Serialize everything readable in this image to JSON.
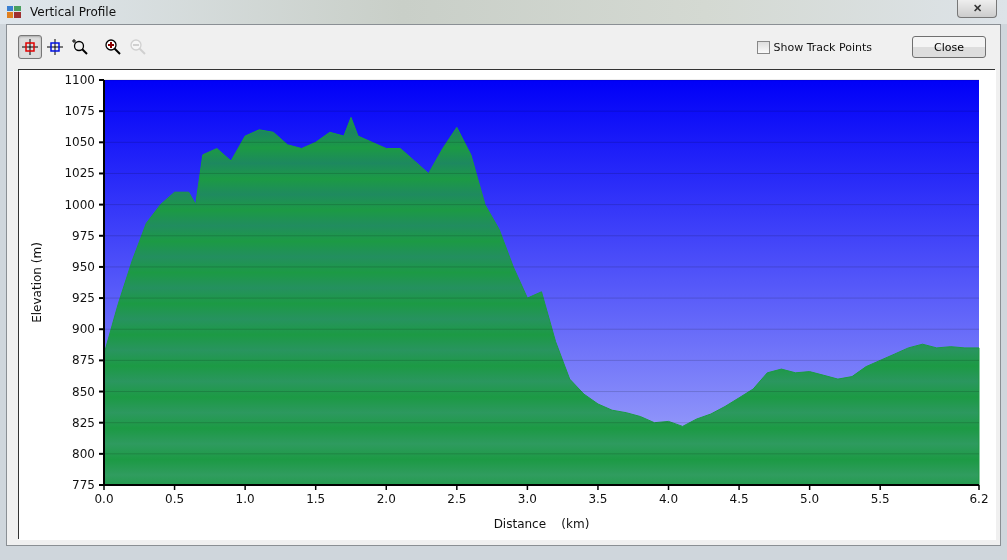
{
  "window": {
    "title": "Vertical Profile",
    "close_glyph": "✕"
  },
  "toolbar": [
    {
      "kind": "pick-red",
      "selected": true,
      "disabled": false
    },
    {
      "kind": "pick-blue",
      "selected": false,
      "disabled": false
    },
    {
      "kind": "zoom-box",
      "selected": false,
      "disabled": false
    },
    {
      "kind": "zoom-in",
      "selected": false,
      "disabled": false
    },
    {
      "kind": "zoom-out",
      "selected": false,
      "disabled": true
    }
  ],
  "show_track_points": {
    "label": "Show Track Points",
    "checked": false
  },
  "close_button": "Close",
  "chart_data": {
    "type": "area",
    "xlabel": "Distance    (km)",
    "ylabel": "Elevation (m)",
    "x": [
      0,
      0.1,
      0.2,
      0.3,
      0.4,
      0.5,
      0.6,
      0.65,
      0.7,
      0.8,
      0.9,
      1.0,
      1.1,
      1.2,
      1.3,
      1.4,
      1.5,
      1.6,
      1.7,
      1.75,
      1.8,
      1.9,
      2.0,
      2.1,
      2.2,
      2.3,
      2.4,
      2.5,
      2.6,
      2.7,
      2.8,
      2.9,
      3.0,
      3.1,
      3.2,
      3.3,
      3.4,
      3.5,
      3.6,
      3.7,
      3.8,
      3.9,
      4.0,
      4.1,
      4.2,
      4.3,
      4.4,
      4.5,
      4.6,
      4.7,
      4.8,
      4.9,
      5.0,
      5.1,
      5.2,
      5.3,
      5.4,
      5.5,
      5.6,
      5.7,
      5.8,
      5.9,
      6.0,
      6.1,
      6.2
    ],
    "series": [
      {
        "color": "#1c9a44",
        "values": [
          880,
          920,
          955,
          985,
          1000,
          1010,
          1010,
          1000,
          1040,
          1045,
          1035,
          1055,
          1060,
          1058,
          1048,
          1045,
          1050,
          1058,
          1055,
          1070,
          1055,
          1050,
          1045,
          1045,
          1035,
          1025,
          1045,
          1062,
          1040,
          1000,
          980,
          950,
          925,
          930,
          890,
          860,
          848,
          840,
          835,
          833,
          830,
          825,
          826,
          822,
          828,
          832,
          838,
          845,
          852,
          865,
          868,
          865,
          866,
          863,
          860,
          862,
          870,
          875,
          880,
          885,
          888,
          885,
          886,
          885,
          885
        ]
      }
    ],
    "grid": true,
    "xlim": [
      0,
      6.2
    ],
    "ylim": [
      775,
      1100
    ],
    "xticks": [
      {
        "value": 0,
        "label": "0.0"
      },
      0.5,
      {
        "value": 1,
        "label": "1.0"
      },
      1.5,
      {
        "value": 2,
        "label": "2.0"
      },
      2.5,
      {
        "value": 3,
        "label": "3.0"
      },
      3.5,
      {
        "value": 4,
        "label": "4.0"
      },
      4.5,
      {
        "value": 5,
        "label": "5.0"
      },
      5.5,
      6.2
    ],
    "yticks": [
      775,
      800,
      825,
      850,
      875,
      900,
      925,
      950,
      975,
      1000,
      1025,
      1050,
      1075,
      1100
    ]
  }
}
